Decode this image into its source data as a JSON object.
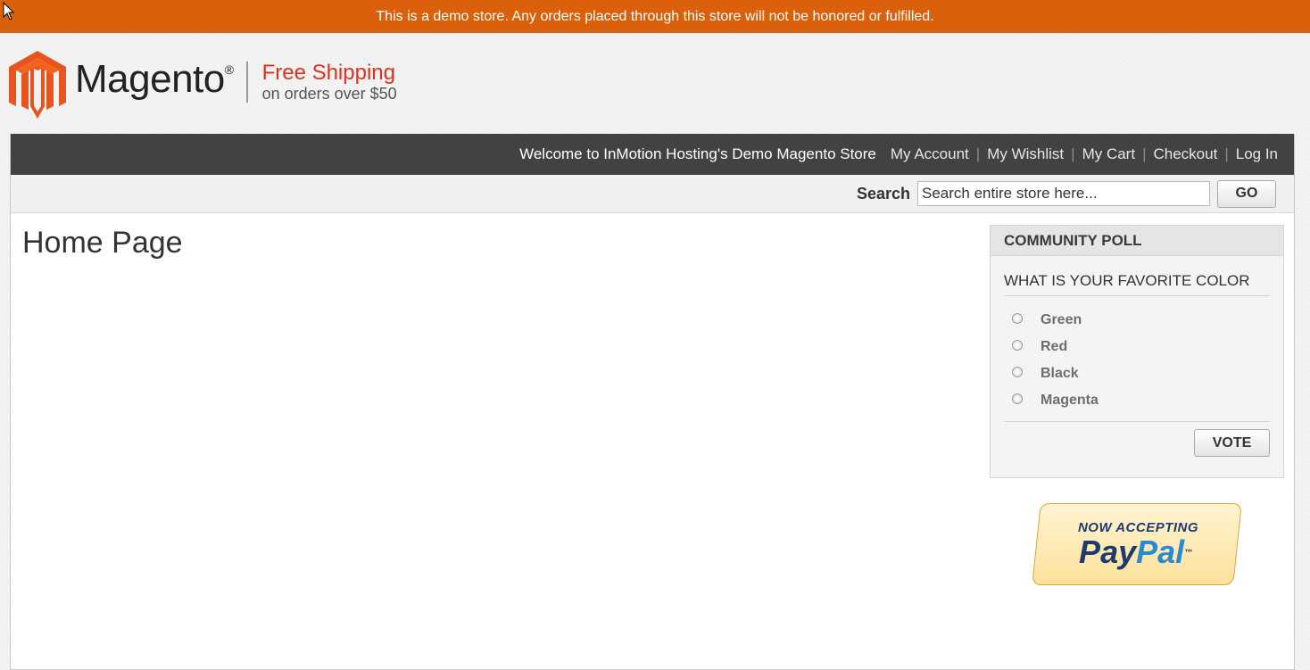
{
  "notice": "This is a demo store. Any orders placed through this store will not be honored or fulfilled.",
  "logo": {
    "brand": "Magento",
    "registered": "®",
    "shipping_title": "Free Shipping",
    "shipping_sub": "on orders over $50"
  },
  "header": {
    "welcome": "Welcome to InMotion Hosting's Demo Magento Store",
    "links": [
      "My Account",
      "My Wishlist",
      "My Cart",
      "Checkout",
      "Log In"
    ],
    "separator": "|"
  },
  "search": {
    "label": "Search",
    "placeholder": "Search entire store here...",
    "button": "GO"
  },
  "page": {
    "title": "Home Page"
  },
  "poll": {
    "title": "COMMUNITY POLL",
    "question": "WHAT IS YOUR FAVORITE COLOR",
    "options": [
      "Green",
      "Red",
      "Black",
      "Magenta"
    ],
    "vote_label": "VOTE"
  },
  "paypal": {
    "tagline": "NOW ACCEPTING",
    "pay": "Pay",
    "pal": "Pal",
    "tm": "™"
  },
  "colors": {
    "notice_bg": "#db600b",
    "nav_bg": "#424242",
    "shipping_red": "#e0301e",
    "magento_orange": "#e8541e"
  },
  "icons": {
    "cursor": "arrow-cursor-icon",
    "logo": "magento-logo-icon"
  }
}
